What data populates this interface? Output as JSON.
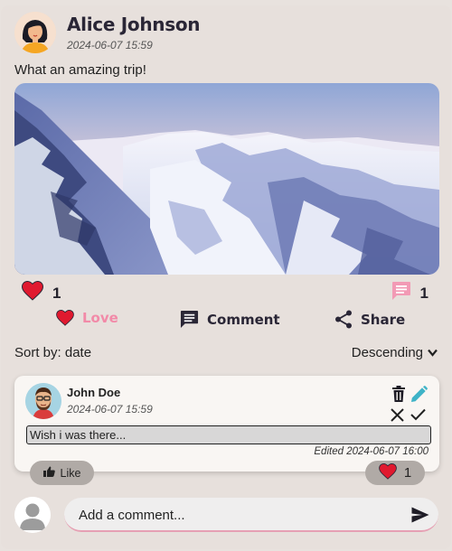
{
  "post": {
    "author": "Alice Johnson",
    "timestamp": "2024-06-07 15:59",
    "text": "What an amazing trip!",
    "image_alt": "Snowy mountain range at sunset",
    "likes_count": "1",
    "comments_count": "1"
  },
  "actions": {
    "love_label": "Love",
    "comment_label": "Comment",
    "share_label": "Share"
  },
  "sort": {
    "label": "Sort by: date",
    "order": "Descending"
  },
  "comment": {
    "author": "John Doe",
    "timestamp": "2024-06-07 15:59",
    "text": "Wish i was there...",
    "edited": "Edited 2024-06-07 16:00",
    "like_label": "Like",
    "reactions_count": "1"
  },
  "new_comment": {
    "placeholder": "Add a comment..."
  },
  "colors": {
    "background": "#e8e2de",
    "accent_pink": "#f28aa8",
    "heart_red": "#e0192f",
    "text_dark": "#2a2636",
    "teal_edit": "#3fb3c7"
  },
  "icons": [
    "heart-icon",
    "comment-bubble-icon",
    "share-icon",
    "chevron-down-icon",
    "trash-icon",
    "pencil-icon",
    "close-icon",
    "check-icon",
    "thumbs-up-icon",
    "send-icon",
    "user-avatar-icon"
  ]
}
